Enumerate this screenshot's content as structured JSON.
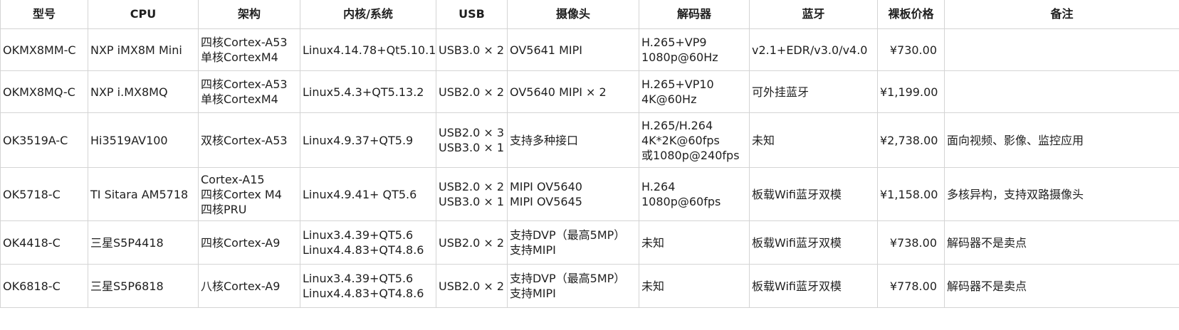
{
  "header": [
    "型号",
    "CPU",
    "架构",
    "内核/系统",
    "USB",
    "摄像头",
    "解码器",
    "蓝牙",
    "裸板价格",
    "备注"
  ],
  "rows": [
    {
      "model": "OKMX8MM-C",
      "cpu": "NXP iMX8M Mini",
      "arch": [
        "四核Cortex-A53",
        "单核CortexM4"
      ],
      "os": [
        "Linux4.14.78+Qt5.10.1"
      ],
      "usb": [
        "USB3.0 × 2"
      ],
      "camera": [
        "OV5641 MIPI"
      ],
      "decoder": [
        "H.265+VP9",
        "1080p@60Hz"
      ],
      "bluetooth": "v2.1+EDR/v3.0/v4.0",
      "price": "¥730.00",
      "note": ""
    },
    {
      "model": "OKMX8MQ-C",
      "cpu": "NXP i.MX8MQ",
      "arch": [
        "四核Cortex-A53",
        "单核CortexM4"
      ],
      "os": [
        "Linux5.4.3+QT5.13.2"
      ],
      "usb": [
        "USB2.0 × 2"
      ],
      "camera": [
        "OV5640 MIPI × 2"
      ],
      "decoder": [
        "H.265+VP10",
        "4K@60Hz"
      ],
      "bluetooth": "可外挂蓝牙",
      "price": "¥1,199.00",
      "note": ""
    },
    {
      "model": "OK3519A-C",
      "cpu": "Hi3519AV100",
      "arch": [
        "双核Cortex-A53"
      ],
      "os": [
        "Linux4.9.37+QT5.9"
      ],
      "usb": [
        "USB2.0 × 3",
        "USB3.0 × 1"
      ],
      "camera": [
        "支持多种接口"
      ],
      "decoder": [
        "H.265/H.264",
        "4K*2K@60fps",
        "或1080p@240fps"
      ],
      "bluetooth": "未知",
      "price": "¥2,738.00",
      "note": "面向视频、影像、监控应用"
    },
    {
      "model": "OK5718-C",
      "cpu": "TI Sitara AM5718",
      "arch": [
        "Cortex-A15",
        "四核Cortex M4",
        "四核PRU"
      ],
      "os": [
        "Linux4.9.41+ QT5.6"
      ],
      "usb": [
        "USB2.0 × 2",
        "USB3.0 × 1"
      ],
      "camera": [
        "MIPI OV5640",
        "MIPI OV5645"
      ],
      "decoder": [
        "H.264",
        "1080p@60fps"
      ],
      "bluetooth": "板载Wifi蓝牙双模",
      "price": "¥1,158.00",
      "note": "多核异构，支持双路摄像头"
    },
    {
      "model": "OK4418-C",
      "cpu": "三星S5P4418",
      "arch": [
        "四核Cortex-A9"
      ],
      "os": [
        "Linux3.4.39+QT5.6",
        "Linux4.4.83+QT4.8.6"
      ],
      "usb": [
        "USB2.0 × 2"
      ],
      "camera": [
        "支持DVP（最高5MP）",
        "支持MIPI"
      ],
      "decoder": [
        "未知"
      ],
      "bluetooth": "板载Wifi蓝牙双模",
      "price": "¥738.00",
      "note": "解码器不是卖点"
    },
    {
      "model": "OK6818-C",
      "cpu": "三星S5P6818",
      "arch": [
        "八核Cortex-A9"
      ],
      "os": [
        "Linux3.4.39+QT5.6",
        "Linux4.4.83+QT4.8.6"
      ],
      "usb": [
        "USB2.0 × 2"
      ],
      "camera": [
        "支持DVP（最高5MP）",
        "支持MIPI"
      ],
      "decoder": [
        "未知"
      ],
      "bluetooth": "板载Wifi蓝牙双模",
      "price": "¥778.00",
      "note": "解码器不是卖点"
    }
  ]
}
